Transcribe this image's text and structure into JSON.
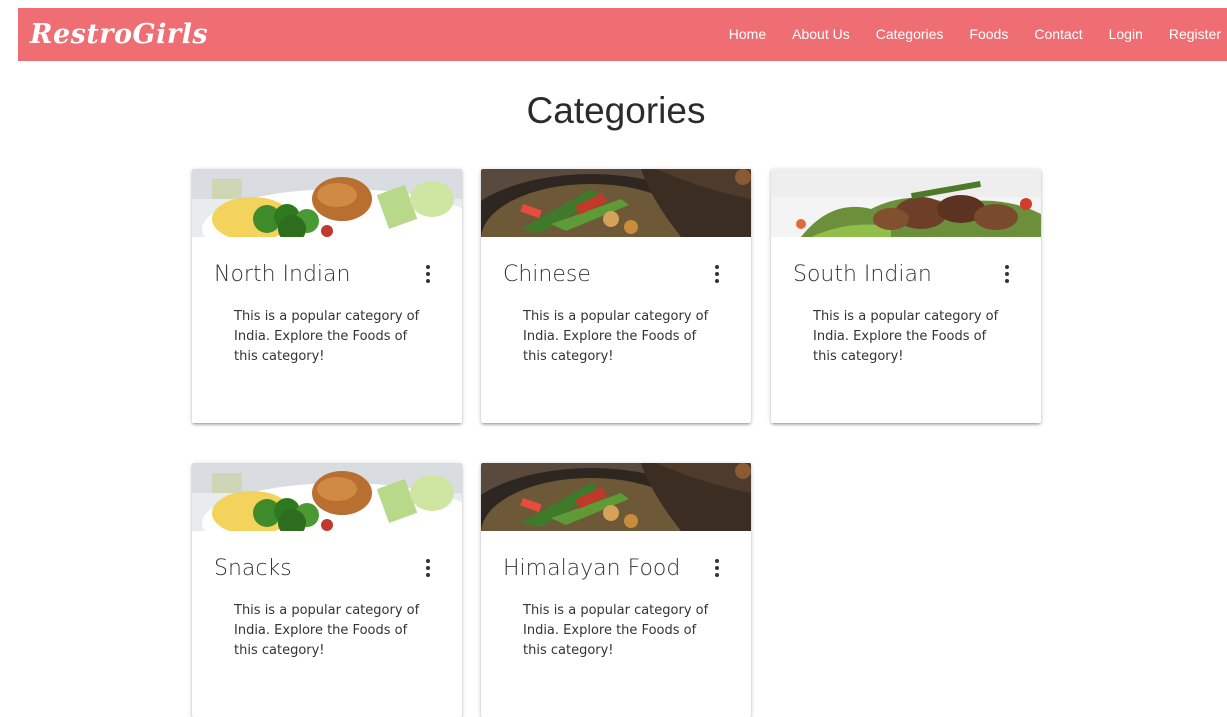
{
  "brand": {
    "name": "RestroGirls"
  },
  "nav": {
    "items": [
      {
        "label": "Home"
      },
      {
        "label": "About Us"
      },
      {
        "label": "Categories"
      },
      {
        "label": "Foods"
      },
      {
        "label": "Contact"
      },
      {
        "label": "Login"
      },
      {
        "label": "Register"
      }
    ]
  },
  "page": {
    "title": "Categories"
  },
  "categories": [
    {
      "title": "North Indian",
      "description": "This is a popular category of India. Explore the Foods of this category!",
      "image": "plate-broccoli"
    },
    {
      "title": "Chinese",
      "description": "This is a popular category of India. Explore the Foods of this category!",
      "image": "wok-stirfry"
    },
    {
      "title": "South Indian",
      "description": "This is a popular category of India. Explore the Foods of this category!",
      "image": "beef-salad"
    },
    {
      "title": "Snacks",
      "description": "This is a popular category of India. Explore the Foods of this category!",
      "image": "plate-broccoli"
    },
    {
      "title": "Himalayan Food",
      "description": "This is a popular category of India. Explore the Foods of this category!",
      "image": "wok-stirfry"
    }
  ],
  "colors": {
    "navbar": "#ee6e73",
    "text": "#333333"
  },
  "icons": {
    "card_menu": "more-vert-icon"
  }
}
